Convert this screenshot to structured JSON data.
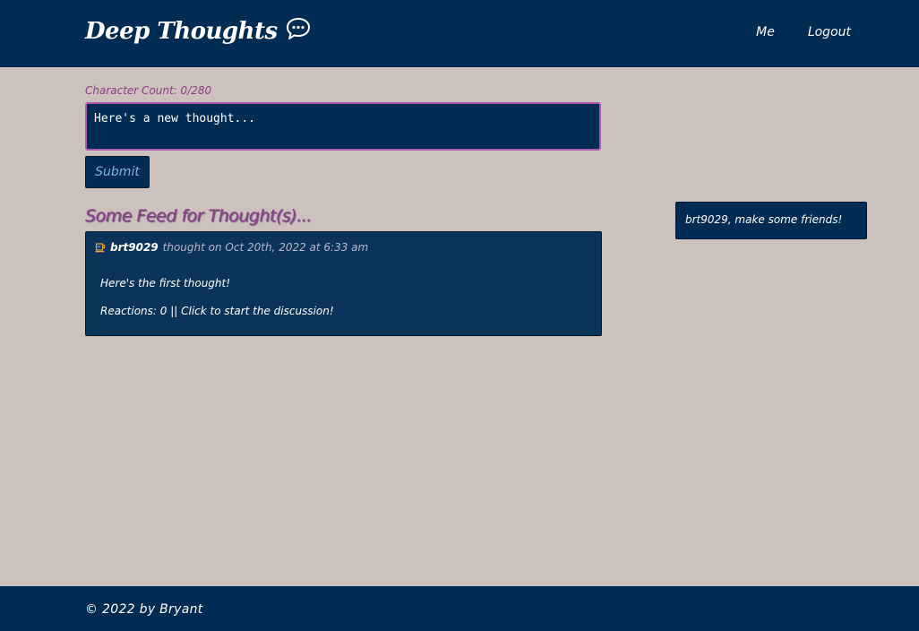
{
  "header": {
    "brand": "Deep Thoughts",
    "brand_icon": "speech-bubble-icon",
    "nav": {
      "me": "Me",
      "logout": "Logout"
    }
  },
  "form": {
    "char_count": "Character Count: 0/280",
    "placeholder": "Here's a new thought...",
    "submit": "Submit"
  },
  "feed": {
    "title": "Some Feed for Thought(s)...",
    "thoughts": [
      {
        "icon": "coffee-cup-icon",
        "username": "brt9029",
        "meta": "thought on Oct 20th, 2022 at 6:33 am",
        "text": "Here's the first thought!",
        "reactions": "Reactions: 0 || Click to start the discussion!"
      }
    ]
  },
  "friends": {
    "message": "brt9029, make some friends!"
  },
  "footer": {
    "text": "© 2022 by Bryant"
  },
  "colors": {
    "background": "#cdc1bd",
    "navy": "#002b52",
    "card": "#0b345a",
    "accent": "#8d3e8a",
    "input_border": "#b05bb0",
    "submit_text": "#7fb2e3"
  }
}
